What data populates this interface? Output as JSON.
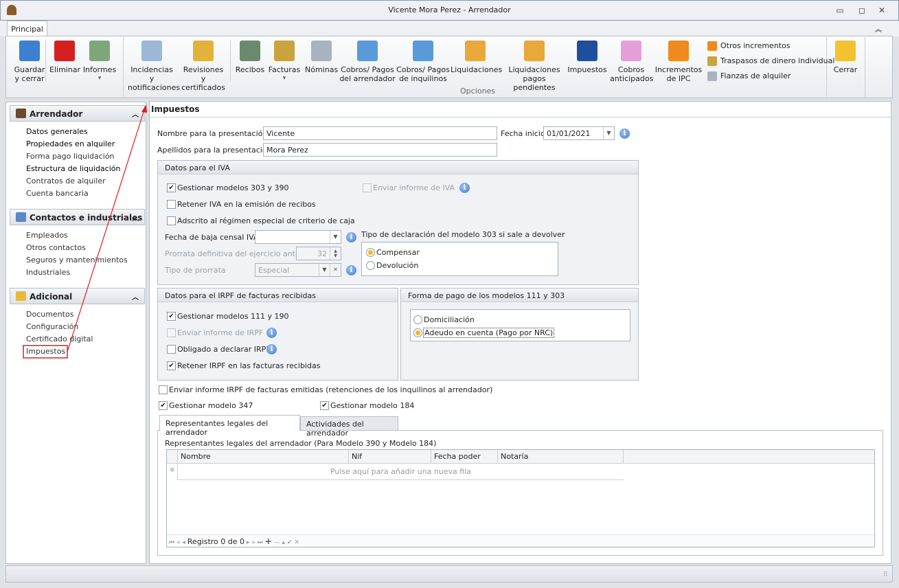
{
  "window": {
    "title": "Vicente Mora Perez - Arrendador",
    "minimize": "▭",
    "restore": "◻",
    "close": "✕"
  },
  "ribbon": {
    "tab": "Principal",
    "collapse": "︽",
    "group_label": "Opciones",
    "buttons": [
      {
        "id": "guardar",
        "l1": "Guardar",
        "l2": "y cerrar",
        "icon": "floppy-disk-icon",
        "color": "#3d7fd1"
      },
      {
        "id": "eliminar",
        "l1": "Eliminar",
        "l2": "",
        "icon": "red-x-icon",
        "color": "#d42020"
      },
      {
        "id": "informes",
        "l1": "Informes",
        "l2": "▾",
        "icon": "report-icon",
        "color": "#7fa67a"
      },
      {
        "id": "incidencias",
        "l1": "Incidencias y",
        "l2": "notificaciones",
        "icon": "envelope-check-icon",
        "color": "#9cb8d6"
      },
      {
        "id": "revisiones",
        "l1": "Revisiones y",
        "l2": "certificados",
        "icon": "bell-report-icon",
        "color": "#e2b23a"
      },
      {
        "id": "recibos",
        "l1": "Recibos",
        "l2": "",
        "icon": "receipt-icon",
        "color": "#6a8a6e"
      },
      {
        "id": "facturas",
        "l1": "Facturas",
        "l2": "▾",
        "icon": "invoice-coins-icon",
        "color": "#c9a43e"
      },
      {
        "id": "nominas",
        "l1": "Nóminas",
        "l2": "",
        "icon": "calendar-icon",
        "color": "#a9b3c0"
      },
      {
        "id": "cobros_arr",
        "l1": "Cobros/ Pagos",
        "l2": "del arrendador",
        "icon": "calculator-icon",
        "color": "#5a9ad9"
      },
      {
        "id": "cobros_inq",
        "l1": "Cobros/ Pagos",
        "l2": "de inquilinos",
        "icon": "calculator-person-icon",
        "color": "#5a9ad9"
      },
      {
        "id": "liquidaciones",
        "l1": "Liquidaciones",
        "l2": "",
        "icon": "certificate-icon",
        "color": "#e8a83a"
      },
      {
        "id": "liq_pend",
        "l1": "Liquidaciones",
        "l2": "pagos pendientes",
        "icon": "certificate-icon",
        "color": "#e8a83a"
      },
      {
        "id": "impuestos",
        "l1": "Impuestos",
        "l2": "",
        "icon": "tax-agency-icon",
        "color": "#1f4e9c"
      },
      {
        "id": "cobros_ant",
        "l1": "Cobros",
        "l2": "anticipados",
        "icon": "piggy-bank-icon",
        "color": "#e4a0d6"
      },
      {
        "id": "incrementos",
        "l1": "Incrementos",
        "l2": "de IPC",
        "icon": "increase-arrows-icon",
        "color": "#f08a1e"
      },
      {
        "id": "cerrar",
        "l1": "Cerrar",
        "l2": "",
        "icon": "folder-exit-icon",
        "color": "#f2c230"
      }
    ],
    "small_buttons": [
      {
        "label": "Otros incrementos",
        "icon": "increase-small-icon",
        "color": "#f08a1e"
      },
      {
        "label": "Traspasos de dinero individual",
        "icon": "money-transfer-icon",
        "color": "#c9a43e"
      },
      {
        "label": "Fianzas de alquiler",
        "icon": "safe-icon",
        "color": "#a9b3c0"
      }
    ]
  },
  "sidebar": {
    "sections": [
      {
        "title": "Arrendador",
        "icon": "landlord-icon",
        "color": "#6b4a2a",
        "items": [
          "Datos generales",
          "Propiedades en alquiler",
          "Forma pago liquidación",
          "Estructura de liquidación",
          "Contratos de alquiler",
          "Cuenta bancaria"
        ]
      },
      {
        "title": "Contactos e industriales",
        "icon": "contacts-icon",
        "color": "#5a88c8",
        "items": [
          "Empleados",
          "Otros contactos",
          "Seguros y mantenimientos",
          "Industriales"
        ]
      },
      {
        "title": "Adicional",
        "icon": "database-icon",
        "color": "#e8b93a",
        "items": [
          "Documentos",
          "Configuración",
          "Certificado digital",
          "Impuestos"
        ]
      }
    ]
  },
  "main": {
    "title": "Impuestos",
    "nombre_label": "Nombre para la presentación:",
    "nombre_value": "Vicente",
    "apellidos_label": "Apellidos para la presentación:",
    "apellidos_value": "Mora Perez",
    "fecha_inicio_label": "Fecha inicio:",
    "fecha_inicio_value": "01/01/2021",
    "iva": {
      "title": "Datos para el IVA",
      "gestionar": "Gestionar modelos 303 y 390",
      "retener": "Retener IVA en la emisión de recibos",
      "adscrito": "Adscrito al régimen especial de criterio de caja",
      "enviar": "Enviar informe de IVA",
      "fecha_baja_label": "Fecha de baja censal IVA",
      "fecha_baja_value": "",
      "prorrata_label": "Prorrata definitiva del ejercicio anterior",
      "prorrata_value": "32",
      "tipo_prorrata_label": "Tipo de prorrata",
      "tipo_prorrata_value": "Especial",
      "tipo_decl_label": "Tipo de declaración del modelo 303 si sale a devolver",
      "compensar": "Compensar",
      "devolucion": "Devolución"
    },
    "irpf": {
      "title": "Datos para el IRPF de facturas recibidas",
      "gestionar": "Gestionar modelos 111 y 190",
      "enviar": "Enviar informe de IRPF",
      "obligado": "Obligado a declarar IRPF",
      "retener": "Retener IRPF en las facturas recibidas"
    },
    "forma_pago": {
      "title": "Forma de pago de los modelos 111 y 303",
      "domiciliacion": "Domiciliación",
      "adeudo": "Adeudo en cuenta (Pago por NRC)"
    },
    "enviar_irpf_emitidas": "Enviar informe IRPF de facturas emitidas (retenciones de los inquilinos al arrendador)",
    "modelo347": "Gestionar modelo 347",
    "modelo184": "Gestionar modelo 184",
    "tabs": [
      "Representantes legales del arrendador",
      "Actividades del arrendador"
    ],
    "grid_title": "Representantes legales del arrendador (Para Modelo 390 y Modelo 184)",
    "columns": [
      "Nombre",
      "Nif",
      "Fecha poder",
      "Notaría"
    ],
    "new_row": "Pulse aquí para añadir una nueva fila",
    "new_row_marker": "✲",
    "navigator": {
      "first": "⏮",
      "prev_page": "«",
      "prev": "◂",
      "record": "Registro 0 de 0",
      "next": "▸",
      "next_page": "»",
      "last": "⏭",
      "add": "+",
      "delete": "—",
      "up": "▴",
      "ok": "✔",
      "cancel": "✕"
    }
  }
}
